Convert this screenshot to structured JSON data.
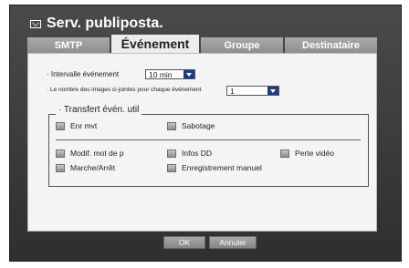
{
  "window": {
    "title": "Serv. publiposta."
  },
  "tabs": [
    {
      "label": "SMTP"
    },
    {
      "label": "Événement"
    },
    {
      "label": "Groupe"
    },
    {
      "label": "Destinataire"
    }
  ],
  "settings": {
    "interval_label": "· Intervalle événement",
    "interval_value": "10 min",
    "images_label": "· Le nombre des images ci-jointes pour chaque événement",
    "images_value": "1"
  },
  "transfer": {
    "title": "· Transfert évén. util",
    "row1": [
      {
        "label": "Enr mvt"
      },
      {
        "label": "Sabotage"
      }
    ],
    "row2": [
      {
        "label": "Modif. mot de p"
      },
      {
        "label": "Infos DD"
      },
      {
        "label": "Perte vidéo"
      }
    ],
    "row3": [
      {
        "label": "Marche/Arrêt"
      },
      {
        "label": "Enregistrement manuel"
      }
    ]
  },
  "buttons": {
    "ok": "OK",
    "cancel": "Annuler"
  },
  "colors": {
    "frame": "#3b3b3b",
    "panel": "#f4f4f4",
    "dropdown_arrow": "#1c3b8c"
  }
}
